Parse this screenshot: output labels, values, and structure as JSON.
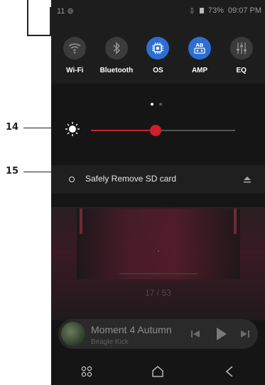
{
  "callouts": {
    "brightness": "14",
    "sd_card": "15"
  },
  "status_bar": {
    "left_icons": "11 ⊚",
    "battery": "73%",
    "time": "09:07 PM"
  },
  "quick_toggles": [
    {
      "label": "Wi-Fi",
      "icon": "wifi-icon",
      "active": false
    },
    {
      "label": "Bluetooth",
      "icon": "bluetooth-icon",
      "active": false
    },
    {
      "label": "OS",
      "icon": "chip-icon",
      "active": true
    },
    {
      "label": "AMP",
      "icon": "amp-icon",
      "active": true
    },
    {
      "label": "EQ",
      "icon": "equalizer-icon",
      "active": false
    }
  ],
  "brightness": {
    "level": 0.45
  },
  "notification": {
    "text": "Safely Remove SD card",
    "icon": "eject-icon"
  },
  "page_counter": "17 / 53",
  "now_playing": {
    "title": "Moment 4 Autumn",
    "artist": "Beagle Kick"
  },
  "colors": {
    "accent": "#2d6ed4",
    "slider": "#d11d2c"
  }
}
